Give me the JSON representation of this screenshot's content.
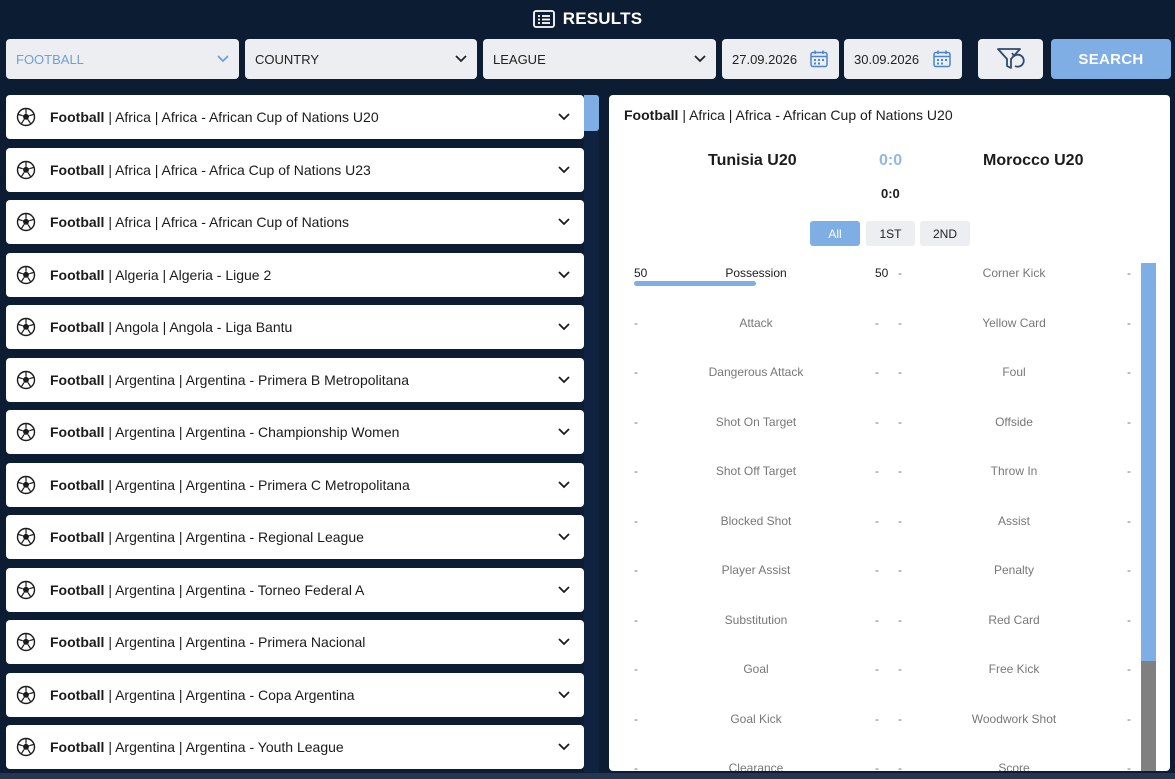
{
  "header": {
    "title": "RESULTS",
    "icon": "results-list-icon"
  },
  "filters": {
    "sport": "FOOTBALL",
    "country": "COUNTRY",
    "league": "LEAGUE",
    "date_from": "27.09.2026",
    "date_to": "30.09.2026",
    "search_label": "SEARCH"
  },
  "leagues": [
    {
      "sport": "Football",
      "path": "| Africa | Africa - African Cup of Nations U20"
    },
    {
      "sport": "Football",
      "path": "| Africa | Africa - Africa Cup of Nations U23"
    },
    {
      "sport": "Football",
      "path": "| Africa | Africa - African Cup of Nations"
    },
    {
      "sport": "Football",
      "path": "| Algeria | Algeria - Ligue 2"
    },
    {
      "sport": "Football",
      "path": "| Angola | Angola - Liga Bantu"
    },
    {
      "sport": "Football",
      "path": "| Argentina | Argentina - Primera B Metropolitana"
    },
    {
      "sport": "Football",
      "path": "| Argentina | Argentina - Championship Women"
    },
    {
      "sport": "Football",
      "path": "| Argentina | Argentina - Primera C Metropolitana"
    },
    {
      "sport": "Football",
      "path": "| Argentina | Argentina - Regional League"
    },
    {
      "sport": "Football",
      "path": "| Argentina | Argentina - Torneo Federal A"
    },
    {
      "sport": "Football",
      "path": "| Argentina | Argentina - Primera Nacional"
    },
    {
      "sport": "Football",
      "path": "| Argentina | Argentina - Copa Argentina"
    },
    {
      "sport": "Football",
      "path": "| Argentina | Argentina - Youth League"
    }
  ],
  "match": {
    "title_sport": "Football",
    "title_path": "| Africa | Africa - African Cup of Nations U20",
    "home": "Tunisia U20",
    "away": "Morocco U20",
    "score": "0:0",
    "score_sub": "0:0",
    "tabs": [
      "All",
      "1ST",
      "2ND"
    ],
    "possession_home_pct": 50
  },
  "stats": [
    {
      "l1": "50",
      "n1": "Possession",
      "r1": "50",
      "l2": "-",
      "n2": "Corner Kick",
      "r2": "-"
    },
    {
      "l1": "-",
      "n1": "Attack",
      "r1": "-",
      "l2": "-",
      "n2": "Yellow Card",
      "r2": "-"
    },
    {
      "l1": "-",
      "n1": "Dangerous Attack",
      "r1": "-",
      "l2": "-",
      "n2": "Foul",
      "r2": "-"
    },
    {
      "l1": "-",
      "n1": "Shot On Target",
      "r1": "-",
      "l2": "-",
      "n2": "Offside",
      "r2": "-"
    },
    {
      "l1": "-",
      "n1": "Shot Off Target",
      "r1": "-",
      "l2": "-",
      "n2": "Throw In",
      "r2": "-"
    },
    {
      "l1": "-",
      "n1": "Blocked Shot",
      "r1": "-",
      "l2": "-",
      "n2": "Assist",
      "r2": "-"
    },
    {
      "l1": "-",
      "n1": "Player Assist",
      "r1": "-",
      "l2": "-",
      "n2": "Penalty",
      "r2": "-"
    },
    {
      "l1": "-",
      "n1": "Substitution",
      "r1": "-",
      "l2": "-",
      "n2": "Red Card",
      "r2": "-"
    },
    {
      "l1": "-",
      "n1": "Goal",
      "r1": "-",
      "l2": "-",
      "n2": "Free Kick",
      "r2": "-"
    },
    {
      "l1": "-",
      "n1": "Goal Kick",
      "r1": "-",
      "l2": "-",
      "n2": "Woodwork Shot",
      "r2": "-"
    },
    {
      "l1": "-",
      "n1": "Clearance",
      "r1": "-",
      "l2": "-",
      "n2": "Score",
      "r2": "-"
    }
  ],
  "colors": {
    "background": "#0c1d33",
    "accent": "#7eaee4",
    "score": "#8fb8e8"
  }
}
